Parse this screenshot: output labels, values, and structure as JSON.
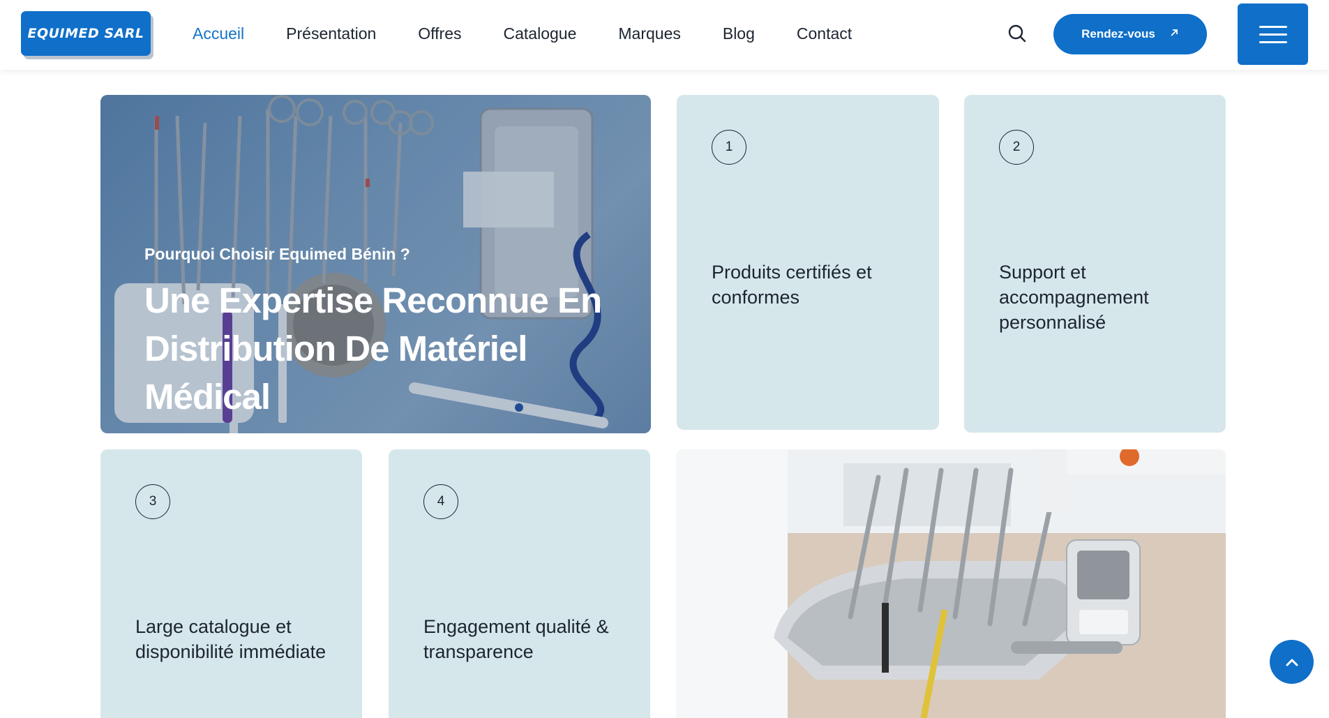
{
  "header": {
    "logo_text": "EQUIMED SARL",
    "nav": [
      {
        "label": "Accueil",
        "active": true
      },
      {
        "label": "Présentation"
      },
      {
        "label": "Offres"
      },
      {
        "label": "Catalogue"
      },
      {
        "label": "Marques"
      },
      {
        "label": "Blog"
      },
      {
        "label": "Contact"
      }
    ],
    "search_icon": "search-icon",
    "cta_label": "Rendez-vous",
    "cta_icon": "arrow-up-right-icon",
    "menu_icon": "hamburger-icon"
  },
  "hero": {
    "subtitle": "Pourquoi Choisir Equimed Bénin ?",
    "title": "Une Expertise Reconnue En Distribution De Matériel Médical"
  },
  "features": [
    {
      "number": "1",
      "text": "Produits certifiés et conformes"
    },
    {
      "number": "2",
      "text": "Support et accompagnement personnalisé"
    },
    {
      "number": "3",
      "text": "Large catalogue et disponibilité immédiate"
    },
    {
      "number": "4",
      "text": "Engagement qualité & transparence"
    }
  ],
  "back_to_top_icon": "chevron-up-icon",
  "colors": {
    "brand": "#0f6fc9",
    "card_bg": "#d6e7ec",
    "text": "#1c2430",
    "active_nav": "#1473c8"
  }
}
